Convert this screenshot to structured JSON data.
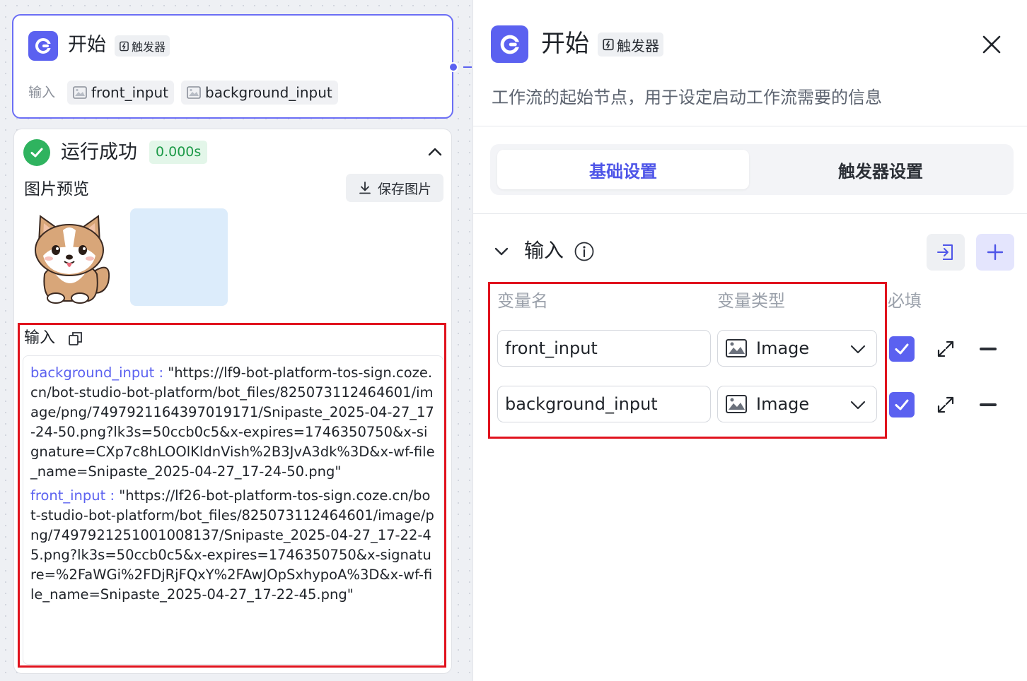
{
  "start_node": {
    "title": "开始",
    "badge": "触发器",
    "input_label": "输入",
    "inputs": [
      "front_input",
      "background_input"
    ]
  },
  "result": {
    "status": "运行成功",
    "duration": "0.000s",
    "preview_title": "图片预览",
    "save_label": "保存图片",
    "input_title": "输入",
    "entries": [
      {
        "key": "background_input",
        "sep": " : ",
        "value": "\"https://lf9-bot-platform-tos-sign.coze.cn/bot-studio-bot-platform/bot_files/825073112464601/image/png/7497921164397019171/Snipaste_2025-04-27_17-24-50.png?lk3s=50ccb0c5&x-expires=1746350750&x-signature=CXp7c8hLOOlKldnVish%2B3JvA3dk%3D&x-wf-file_name=Snipaste_2025-04-27_17-24-50.png\""
      },
      {
        "key": "front_input",
        "sep": " : ",
        "value": "\"https://lf26-bot-platform-tos-sign.coze.cn/bot-studio-bot-platform/bot_files/825073112464601/image/png/7497921251001008137/Snipaste_2025-04-27_17-22-45.png?lk3s=50ccb0c5&x-expires=1746350750&x-signature=%2FaWGi%2FDjRjFQxY%2FAwJOpSxhypoA%3D&x-wf-file_name=Snipaste_2025-04-27_17-22-45.png\""
      }
    ]
  },
  "panel": {
    "title": "开始",
    "badge": "触发器",
    "description": "工作流的起始节点，用于设定启动工作流需要的信息",
    "tabs": [
      {
        "label": "基础设置",
        "active": true
      },
      {
        "label": "触发器设置",
        "active": false
      }
    ],
    "section_title": "输入",
    "columns": {
      "name": "变量名",
      "type": "变量类型",
      "required": "必填"
    },
    "rows": [
      {
        "name": "front_input",
        "type": "Image",
        "required": true
      },
      {
        "name": "background_input",
        "type": "Image",
        "required": true
      }
    ]
  },
  "colors": {
    "accent": "#5b61f0",
    "success": "#2fb35f",
    "highlight_box": "#e0121d"
  }
}
